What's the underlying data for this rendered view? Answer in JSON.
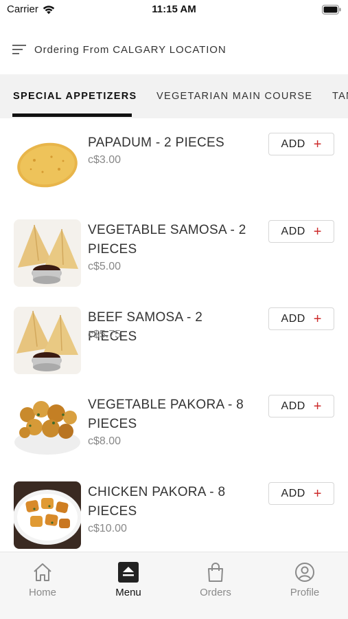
{
  "status_bar": {
    "carrier": "Carrier",
    "time": "11:15 AM"
  },
  "header": {
    "title": "Ordering From CALGARY LOCATION",
    "menu_icon": "filter-lines-icon"
  },
  "tabs": [
    {
      "label": "SPECIAL APPETIZERS",
      "active": true
    },
    {
      "label": "VEGETARIAN MAIN COURSE",
      "active": false
    },
    {
      "label": "TAN",
      "active": false
    }
  ],
  "items": [
    {
      "name_line1": "PAPADUM - 2 PIECES",
      "name_line2": "",
      "price": "c$3.00",
      "add_label": "ADD",
      "add_icon": "+"
    },
    {
      "name_line1": "VEGETABLE SAMOSA - 2",
      "name_line2": "PIECES",
      "price": "c$5.00",
      "add_label": "ADD",
      "add_icon": "+"
    },
    {
      "name_line1": "BEEF SAMOSA - 2 PIECES",
      "name_line2": "",
      "price": "c$5.75",
      "add_label": "ADD",
      "add_icon": "+"
    },
    {
      "name_line1": "VEGETABLE PAKORA - 8",
      "name_line2": "PIECES",
      "price": "c$8.00",
      "add_label": "ADD",
      "add_icon": "+"
    },
    {
      "name_line1": "CHICKEN PAKORA - 8",
      "name_line2": "PIECES",
      "price": "c$10.00",
      "add_label": "ADD",
      "add_icon": "+"
    }
  ],
  "bottom_nav": [
    {
      "label": "Home",
      "icon": "home-icon",
      "active": false
    },
    {
      "label": "Menu",
      "icon": "menu-icon",
      "active": true
    },
    {
      "label": "Orders",
      "icon": "shopping-bag-icon",
      "active": false
    },
    {
      "label": "Profile",
      "icon": "profile-icon",
      "active": false
    }
  ],
  "colors": {
    "accent_plus": "#cc2a2a",
    "tab_bar_bg": "#f2f2f2",
    "nav_bg": "#f6f6f6"
  }
}
